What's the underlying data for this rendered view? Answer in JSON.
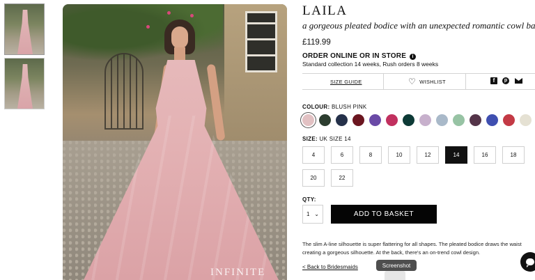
{
  "gallery": {
    "thumbnails": [
      {
        "name": "thumbnail-front"
      },
      {
        "name": "thumbnail-back"
      }
    ],
    "watermark": "INFINITE"
  },
  "product": {
    "name": "LAILA",
    "tagline": "a gorgeous pleated bodice with an unexpected romantic cowl back",
    "price": "£119.99"
  },
  "ordering": {
    "heading": "ORDER ONLINE OR IN STORE",
    "info_icon": "i",
    "delivery_note": "Standard collection 14 weeks, Rush orders 8 weeks"
  },
  "actions": {
    "size_guide": "SIZE GUIDE",
    "wishlist": "WISHLIST",
    "heart_icon": "♡",
    "facebook_icon": "f",
    "pinterest_icon": "p"
  },
  "colour": {
    "label": "COLOUR:",
    "selected": "BLUSH PINK",
    "swatches": [
      "#e2c1c3",
      "#2c3d2f",
      "#25314a",
      "#6b1620",
      "#6a4aa6",
      "#c1305f",
      "#0d3a36",
      "#c7b0cc",
      "#a9b9c9",
      "#97c3a4",
      "#543449",
      "#3f4fb0",
      "#c33a45",
      "#e5e1d3",
      "#dcc6c8"
    ]
  },
  "size": {
    "label": "SIZE:",
    "selected": "UK SIZE 14",
    "options": [
      "4",
      "6",
      "8",
      "10",
      "12",
      "14",
      "16",
      "18",
      "20",
      "22"
    ],
    "active": "14"
  },
  "quantity": {
    "label": "QTY:",
    "value": "1",
    "chevron": "⌄"
  },
  "basket": {
    "label": "ADD TO BASKET"
  },
  "description": {
    "line1": "The slim A-line silhouette is super flattering for all shapes. The pleated bodice draws the waist",
    "line2": "creating a gorgeous silhouette. At the back, there's an on-trend cowl design."
  },
  "navigation": {
    "back_link": "< Back to Bridesmaids"
  },
  "overlay": {
    "tooltip": "Screenshot"
  }
}
